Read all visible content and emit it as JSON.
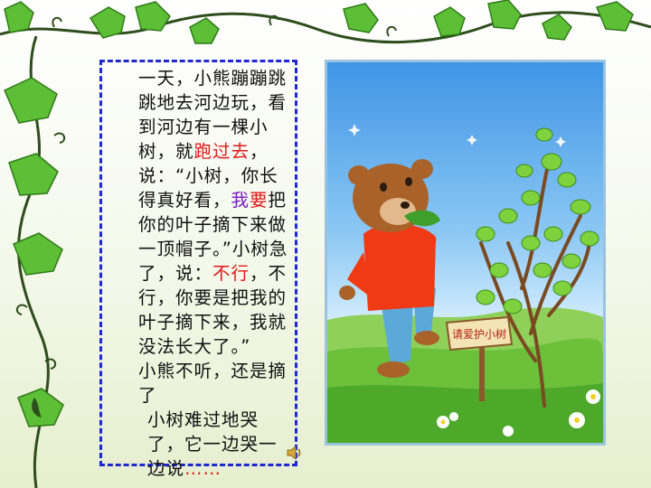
{
  "story": {
    "p1_a": "一天，小熊蹦蹦跳跳",
    "p1_b": "地去河边玩，看到河边有一",
    "p1_c": "棵小树，就",
    "p1_c_red": "跑过去",
    "p1_d": "，说：“小树，你长得真好看，",
    "p1_e_red": "我",
    "p1_f": "要",
    "p1_g": "把你的叶子摘下来做一顶帽子",
    "p1_h": "。”小树急了，说：",
    "p1_h_red": "不行",
    "p1_i": "，不行，你要是把我的叶子摘下来，我就没法长大了。”",
    "p2": "小熊不听，还是摘了",
    "p3_a": "小树难过地哭了，",
    "p3_b": "它一边哭一边说",
    "p3_ellipsis": "……"
  },
  "scene": {
    "sign_text": "请爱护小树",
    "sky_color": "#3f95e6",
    "grass_color": "#6cc03a",
    "shirt_color": "#f03a16",
    "pants_color": "#5ba9d8",
    "fur_color": "#a8622a"
  },
  "icons": {
    "speaker": "speaker-icon"
  }
}
